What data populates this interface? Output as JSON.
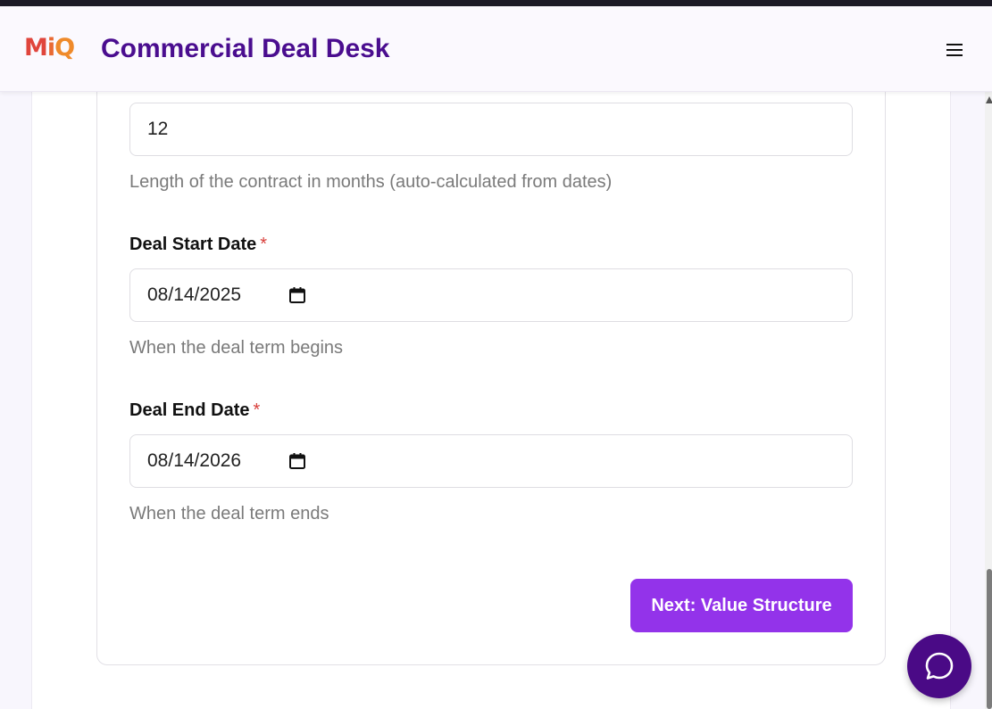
{
  "header": {
    "logo": {
      "part1": "M",
      "part2": "i",
      "part3": "Q"
    },
    "title": "Commercial Deal Desk"
  },
  "form": {
    "duration": {
      "value": "12",
      "help": "Length of the contract in months (auto-calculated from dates)"
    },
    "start_date": {
      "label": "Deal Start Date",
      "required_mark": "*",
      "value": "08/14/2025",
      "help": "When the deal term begins"
    },
    "end_date": {
      "label": "Deal End Date",
      "required_mark": "*",
      "value": "08/14/2026",
      "help": "When the deal term ends"
    },
    "next_button": "Next: Value Structure"
  },
  "icons": {
    "menu": "hamburger-menu-icon",
    "calendar": "calendar-icon",
    "chat": "chat-bubble-icon"
  },
  "colors": {
    "brand_purple": "#4a0d8f",
    "button_purple": "#9333ea",
    "required_red": "#d9413d",
    "chat_fab": "#4a0a86"
  }
}
